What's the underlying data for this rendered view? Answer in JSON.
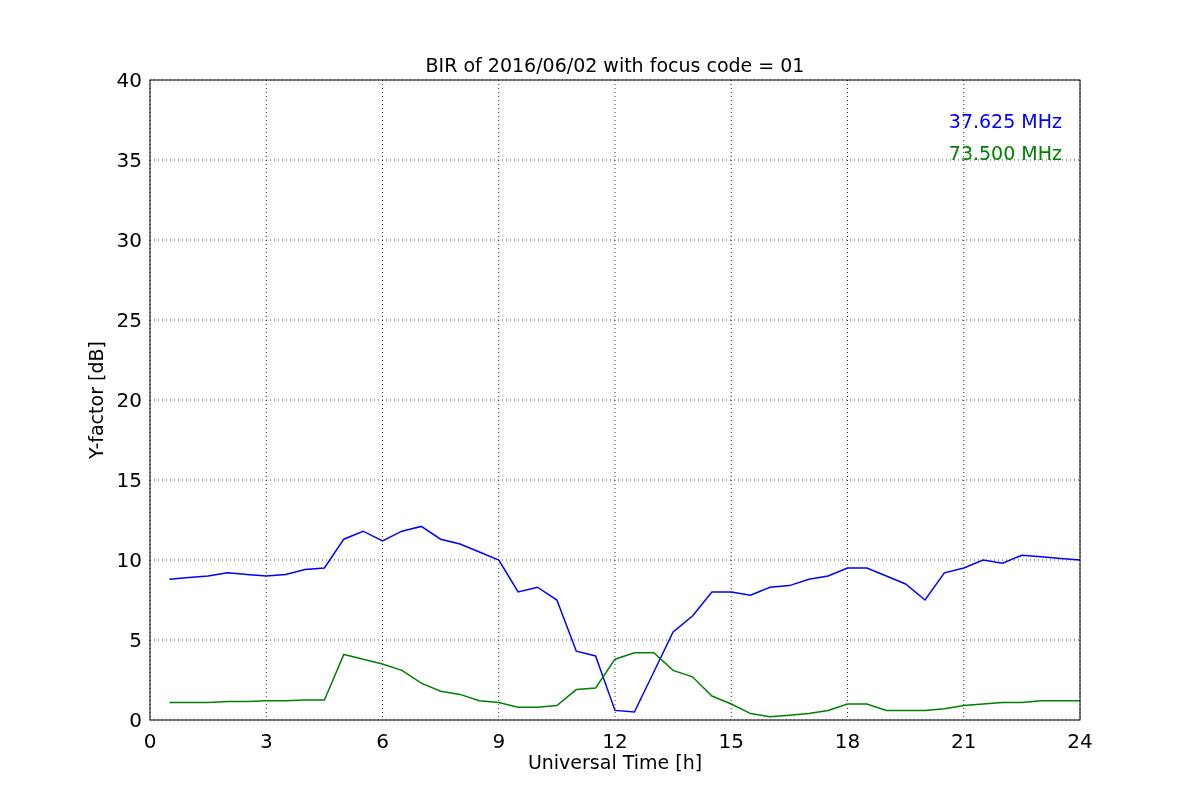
{
  "chart_data": {
    "type": "line",
    "title": "BIR of 2016/06/02 with focus code = 01",
    "xlabel": "Universal Time [h]",
    "ylabel": "Y-factor [dB]",
    "grid": true,
    "x": [
      0.5,
      1,
      1.5,
      2,
      2.5,
      3,
      3.5,
      4,
      4.5,
      5,
      5.5,
      6,
      6.5,
      7,
      7.5,
      8,
      8.5,
      9,
      9.5,
      10,
      10.5,
      11,
      11.5,
      12,
      12.5,
      13,
      13.5,
      14,
      14.5,
      15,
      15.5,
      16,
      16.5,
      17,
      17.5,
      18,
      18.5,
      19,
      19.5,
      20,
      20.5,
      21,
      21.5,
      22,
      22.5,
      23,
      23.5,
      24
    ],
    "series": [
      {
        "name": "37.625 MHz",
        "color": "#0000ff",
        "values": [
          8.8,
          8.9,
          9.0,
          9.2,
          9.1,
          9.0,
          9.1,
          9.4,
          9.5,
          11.3,
          11.8,
          11.2,
          11.8,
          12.1,
          11.3,
          11.0,
          10.5,
          10.0,
          8.0,
          8.3,
          7.5,
          4.3,
          4.0,
          0.6,
          0.5,
          3.0,
          5.5,
          6.5,
          8.0,
          8.0,
          7.8,
          8.3,
          8.4,
          8.8,
          9.0,
          9.5,
          9.5,
          9.0,
          8.5,
          7.5,
          9.2,
          9.5,
          10.0,
          9.8,
          10.3,
          10.2,
          10.1,
          10.0
        ]
      },
      {
        "name": "73.500 MHz",
        "color": "#008000",
        "values": [
          1.1,
          1.1,
          1.1,
          1.15,
          1.15,
          1.2,
          1.2,
          1.25,
          1.25,
          4.1,
          3.8,
          3.5,
          3.1,
          2.3,
          1.8,
          1.6,
          1.2,
          1.1,
          0.8,
          0.8,
          0.9,
          1.9,
          2.0,
          3.8,
          4.2,
          4.2,
          3.1,
          2.7,
          1.5,
          1.0,
          0.4,
          0.2,
          0.3,
          0.4,
          0.6,
          1.0,
          1.0,
          0.6,
          0.6,
          0.6,
          0.7,
          0.9,
          1.0,
          1.1,
          1.1,
          1.2,
          1.2,
          1.2
        ]
      }
    ],
    "xlim": [
      0,
      24
    ],
    "ylim": [
      0,
      40
    ],
    "xticks": [
      0,
      3,
      6,
      9,
      12,
      15,
      18,
      21,
      24
    ],
    "yticks": [
      0,
      5,
      10,
      15,
      20,
      25,
      30,
      35,
      40
    ]
  }
}
